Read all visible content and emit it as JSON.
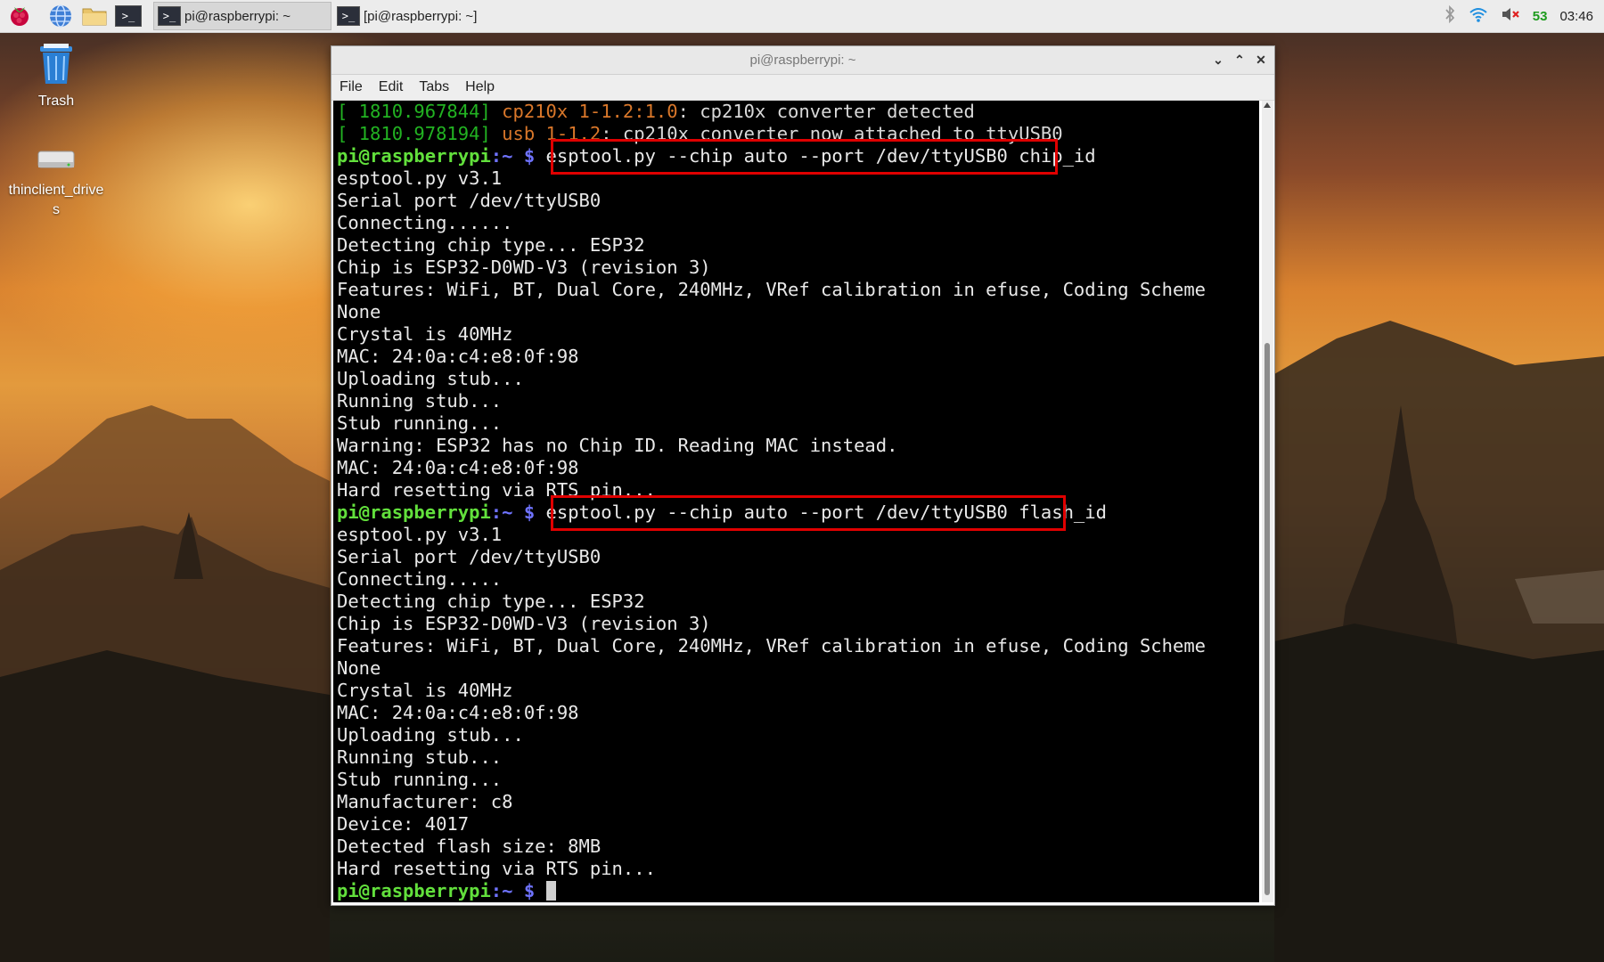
{
  "taskbar": {
    "launchers": [
      {
        "name": "raspberry-menu-icon"
      },
      {
        "name": "web-browser-icon"
      },
      {
        "name": "file-manager-icon"
      },
      {
        "name": "terminal-launcher-icon"
      }
    ],
    "tasks": [
      {
        "label": "pi@raspberrypi: ~",
        "active": true
      },
      {
        "label": "[pi@raspberrypi: ~]",
        "active": false
      }
    ],
    "tray": {
      "cpu": "53",
      "clock": "03:46"
    }
  },
  "desktop": {
    "icons": [
      {
        "label": "Trash",
        "icon": "trash-icon"
      },
      {
        "label": "thinclient_drives",
        "icon": "drive-icon"
      }
    ]
  },
  "window": {
    "title": "pi@raspberrypi: ~",
    "menu": [
      "File",
      "Edit",
      "Tabs",
      "Help"
    ]
  },
  "terminal": {
    "prompt_user": "pi@raspberrypi",
    "prompt_path": ":~ $",
    "lines": [
      {
        "kind": "kernel",
        "timestamp": "[ 1810.967844]",
        "device": "cp210x 1-1.2:1.0",
        "text": ": cp210x converter detected"
      },
      {
        "kind": "kernel",
        "timestamp": "[ 1810.978194]",
        "device": "usb 1-1.2",
        "text": ": cp210x converter now attached to ttyUSB0"
      },
      {
        "kind": "cmd",
        "text": "esptool.py --chip auto --port /dev/ttyUSB0 chip_id"
      },
      {
        "kind": "out",
        "text": "esptool.py v3.1"
      },
      {
        "kind": "out",
        "text": "Serial port /dev/ttyUSB0"
      },
      {
        "kind": "out",
        "text": "Connecting......"
      },
      {
        "kind": "out",
        "text": "Detecting chip type... ESP32"
      },
      {
        "kind": "out",
        "text": "Chip is ESP32-D0WD-V3 (revision 3)"
      },
      {
        "kind": "out",
        "text": "Features: WiFi, BT, Dual Core, 240MHz, VRef calibration in efuse, Coding Scheme"
      },
      {
        "kind": "out",
        "text": "None"
      },
      {
        "kind": "out",
        "text": "Crystal is 40MHz"
      },
      {
        "kind": "out",
        "text": "MAC: 24:0a:c4:e8:0f:98"
      },
      {
        "kind": "out",
        "text": "Uploading stub..."
      },
      {
        "kind": "out",
        "text": "Running stub..."
      },
      {
        "kind": "out",
        "text": "Stub running..."
      },
      {
        "kind": "out",
        "text": "Warning: ESP32 has no Chip ID. Reading MAC instead."
      },
      {
        "kind": "out",
        "text": "MAC: 24:0a:c4:e8:0f:98"
      },
      {
        "kind": "out",
        "text": "Hard resetting via RTS pin..."
      },
      {
        "kind": "cmd",
        "text": "esptool.py --chip auto --port /dev/ttyUSB0 flash_id"
      },
      {
        "kind": "out",
        "text": "esptool.py v3.1"
      },
      {
        "kind": "out",
        "text": "Serial port /dev/ttyUSB0"
      },
      {
        "kind": "out",
        "text": "Connecting....."
      },
      {
        "kind": "out",
        "text": "Detecting chip type... ESP32"
      },
      {
        "kind": "out",
        "text": "Chip is ESP32-D0WD-V3 (revision 3)"
      },
      {
        "kind": "out",
        "text": "Features: WiFi, BT, Dual Core, 240MHz, VRef calibration in efuse, Coding Scheme"
      },
      {
        "kind": "out",
        "text": "None"
      },
      {
        "kind": "out",
        "text": "Crystal is 40MHz"
      },
      {
        "kind": "out",
        "text": "MAC: 24:0a:c4:e8:0f:98"
      },
      {
        "kind": "out",
        "text": "Uploading stub..."
      },
      {
        "kind": "out",
        "text": "Running stub..."
      },
      {
        "kind": "out",
        "text": "Stub running..."
      },
      {
        "kind": "out",
        "text": "Manufacturer: c8"
      },
      {
        "kind": "out",
        "text": "Device: 4017"
      },
      {
        "kind": "out",
        "text": "Detected flash size: 8MB"
      },
      {
        "kind": "out",
        "text": "Hard resetting via RTS pin..."
      },
      {
        "kind": "prompt",
        "text": ""
      }
    ]
  },
  "colors": {
    "highlight_box": "#e00000",
    "prompt_user": "#62e03c",
    "prompt_path": "#6f73ff",
    "kernel_timestamp": "#22b322",
    "kernel_device": "#d9772a"
  }
}
